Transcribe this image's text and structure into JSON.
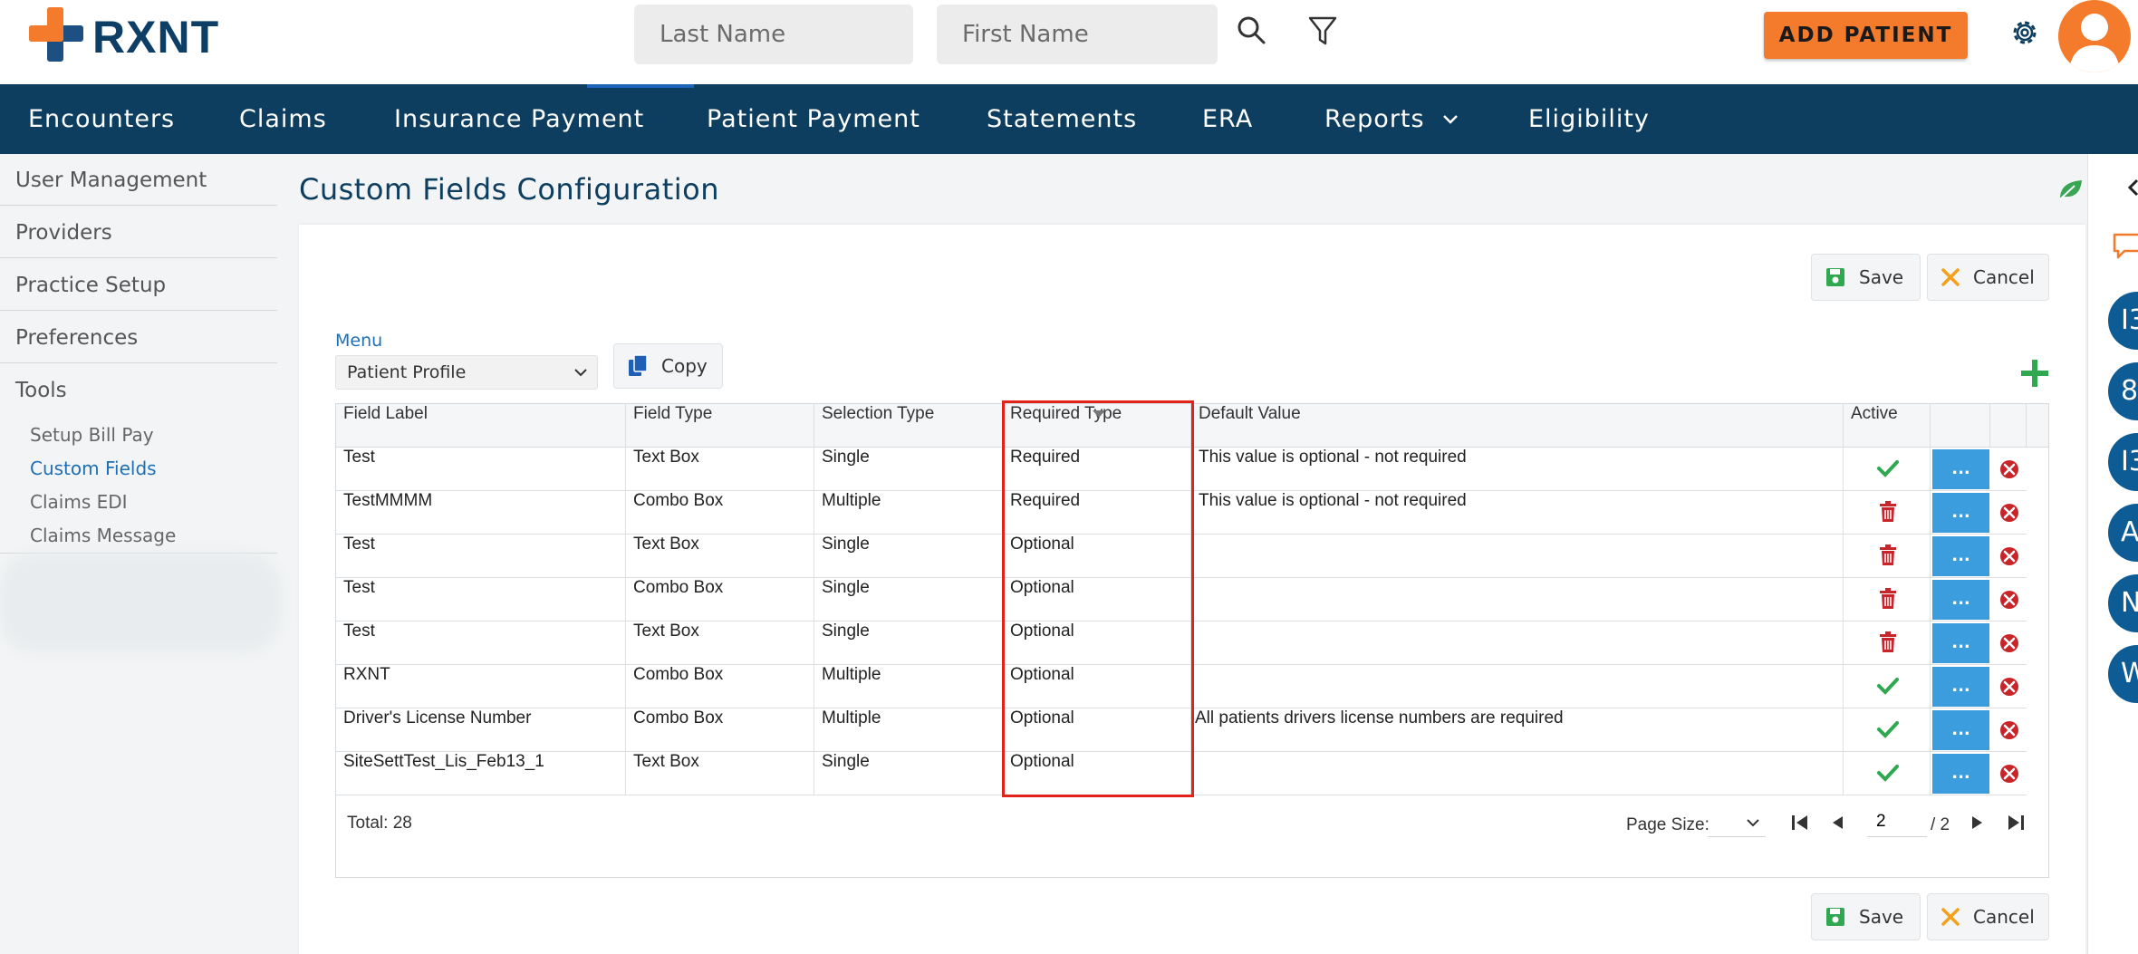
{
  "header": {
    "logo_text": "RXNT",
    "last_name_placeholder": "Last Name",
    "first_name_placeholder": "First Name",
    "add_patient_label": "ADD PATIENT"
  },
  "nav": {
    "items": [
      "Encounters",
      "Claims",
      "Insurance Payment",
      "Patient Payment",
      "Statements",
      "ERA",
      "Reports",
      "Eligibility"
    ]
  },
  "sidebar": {
    "items": [
      "User Management",
      "Providers",
      "Practice Setup",
      "Preferences",
      "Tools"
    ],
    "sub_items": [
      "Setup Bill Pay",
      "Custom Fields",
      "Claims EDI",
      "Claims Message"
    ],
    "active_sub_item": "Custom Fields"
  },
  "page": {
    "title": "Custom Fields Configuration",
    "save_label": "Save",
    "cancel_label": "Cancel",
    "menu_label": "Menu",
    "menu_value": "Patient Profile",
    "copy_label": "Copy"
  },
  "grid": {
    "columns": [
      "Field Label",
      "Field Type",
      "Selection Type",
      "Required Type",
      "Default Value",
      "Active"
    ],
    "sorted_column": "Required Type",
    "rows": [
      {
        "label": "Test",
        "field_type": "Text Box",
        "selection": "Single",
        "required": "Required",
        "default": "This value is optional - not required",
        "active": "check"
      },
      {
        "label": "TestMMMM",
        "field_type": "Combo Box",
        "selection": "Multiple",
        "required": "Required",
        "default": "This value is optional - not required",
        "active": "trash"
      },
      {
        "label": "Test",
        "field_type": "Text Box",
        "selection": "Single",
        "required": "Optional",
        "default": "",
        "active": "trash"
      },
      {
        "label": "Test",
        "field_type": "Combo Box",
        "selection": "Single",
        "required": "Optional",
        "default": "",
        "active": "trash"
      },
      {
        "label": "Test",
        "field_type": "Text Box",
        "selection": "Single",
        "required": "Optional",
        "default": "",
        "active": "trash"
      },
      {
        "label": "RXNT",
        "field_type": "Combo Box",
        "selection": "Multiple",
        "required": "Optional",
        "default": "",
        "active": "check"
      },
      {
        "label": "Driver's License Number",
        "field_type": "Combo Box",
        "selection": "Multiple",
        "required": "Optional",
        "default": "All patients drivers license numbers are required",
        "active": "check"
      },
      {
        "label": "SiteSettTest_Lis_Feb13_1",
        "field_type": "Text Box",
        "selection": "Single",
        "required": "Optional",
        "default": "",
        "active": "check"
      }
    ],
    "more_label": "...",
    "total": "Total: 28",
    "page_size_label": "Page Size:",
    "current_page": "2",
    "page_total": "/ 2"
  },
  "right_rail": {
    "circles": [
      "I3",
      "8(",
      "I3",
      "A",
      "N",
      "W"
    ]
  },
  "colors": {
    "navy": "#0d3e5f",
    "orange": "#f47a2c",
    "blue_button": "#3b9ddd",
    "highlight_red": "#e2231a",
    "check_green": "#2fa84f",
    "trash_red": "#c8242a"
  },
  "icons": [
    "search-icon",
    "filter-icon",
    "gear-icon",
    "avatar",
    "chevron-down-icon",
    "leaf-icon",
    "save-icon",
    "cancel-icon",
    "copy-icon",
    "plus-icon",
    "check-icon",
    "trash-icon",
    "close-circle-icon",
    "first-page-icon",
    "prev-page-icon",
    "next-page-icon",
    "last-page-icon",
    "chat-icon",
    "collapse-icon"
  ]
}
